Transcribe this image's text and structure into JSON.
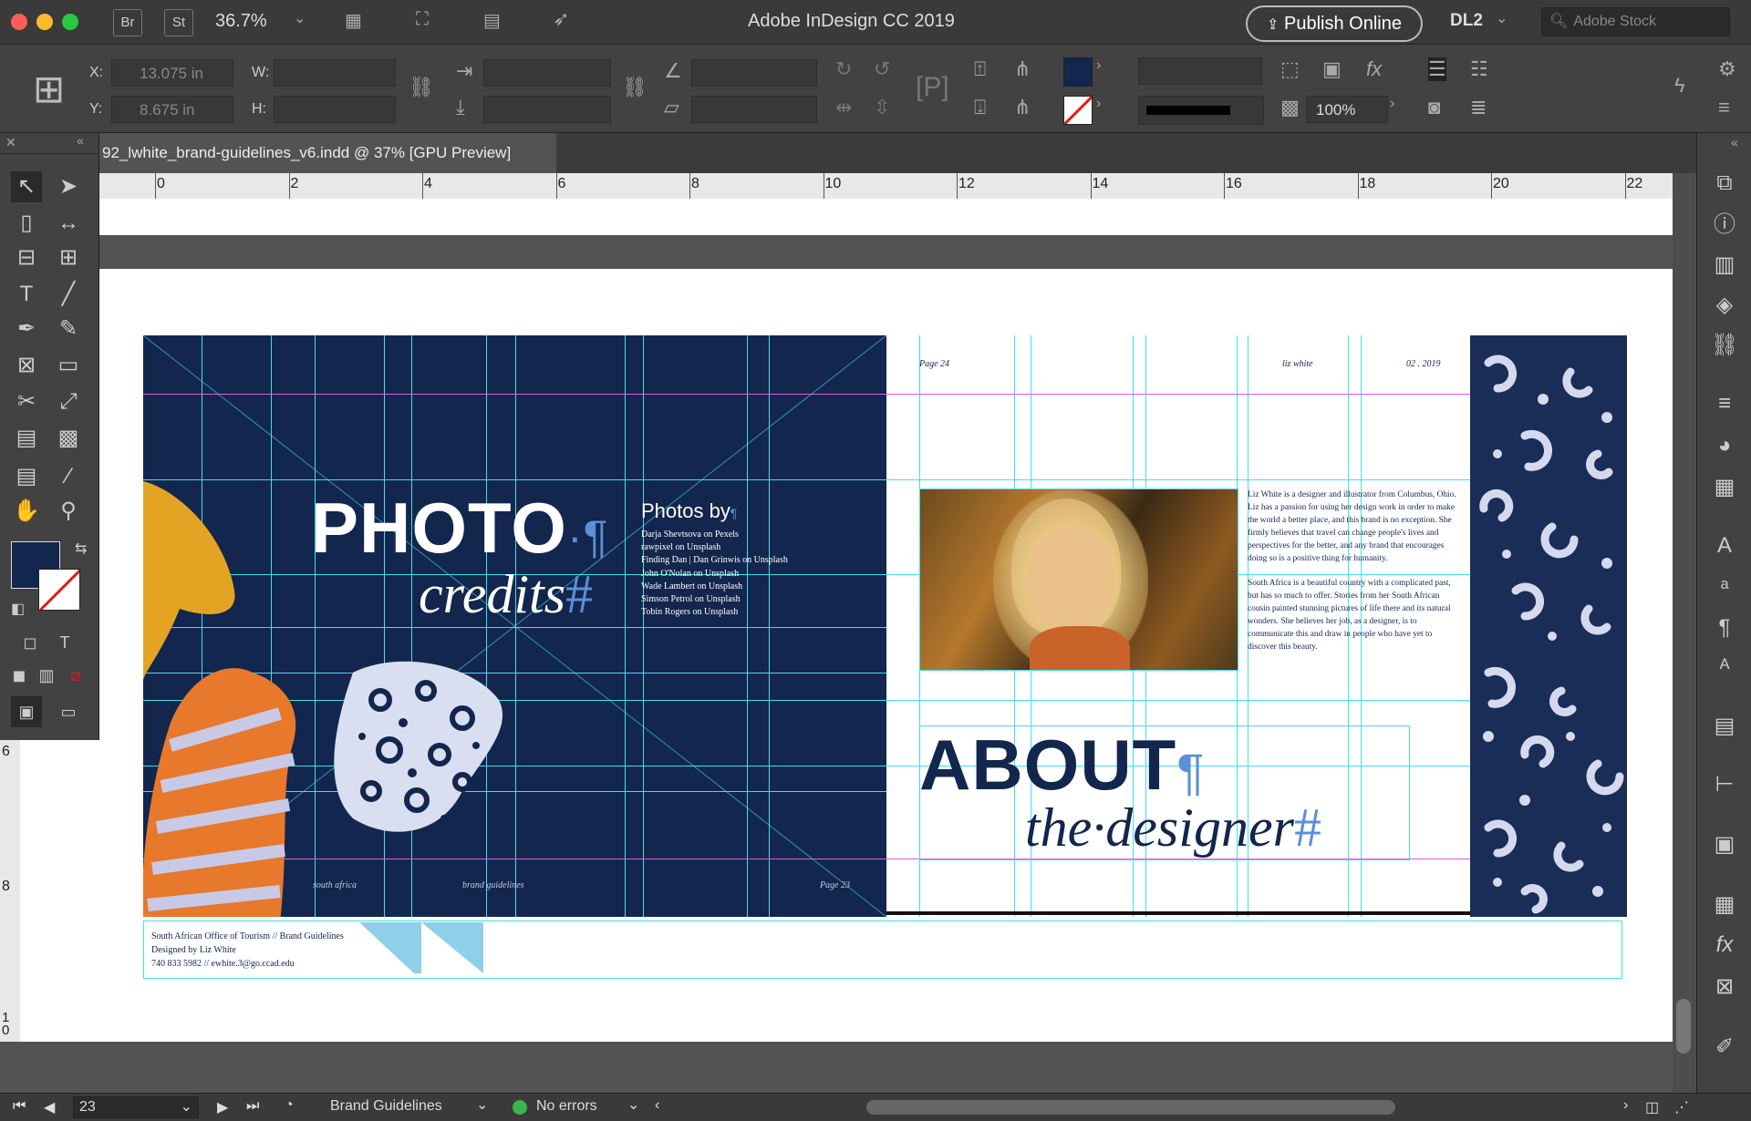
{
  "app": {
    "title": "Adobe InDesign CC 2019",
    "bridge_label": "Br",
    "stock_label": "St",
    "zoom": "36.7%",
    "publish_label": "Publish Online",
    "workspace": "DL2",
    "search_placeholder": "Adobe Stock"
  },
  "control": {
    "x_label": "X:",
    "x_value": "13.075 in",
    "y_label": "Y:",
    "y_value": "8.675 in",
    "w_label": "W:",
    "h_label": "H:",
    "opacity": "100%",
    "fill_color": "#13264d"
  },
  "document": {
    "tab_title": "92_lwhite_brand-guidelines_v6.indd @ 37% [GPU Preview]"
  },
  "ruler": {
    "marks": [
      "0",
      "2",
      "4",
      "6",
      "8",
      "10",
      "12",
      "14",
      "16",
      "18",
      "20",
      "22"
    ],
    "v_marks": [
      "6",
      "8",
      "1\n0"
    ]
  },
  "spread": {
    "left_page": {
      "headline": "PHOTO",
      "headline_mark": "·¶",
      "subhead": "credits",
      "subhead_mark": "#",
      "photos_by": "Photos by",
      "photos_by_mark": "¶",
      "credits": [
        "Darja Shevtsova on Pexels",
        "rawpixel on Unsplash",
        "Finding Dan | Dan Grinwis on Unsplash",
        "John O'Nolan on Unsplash",
        "Wade Lambert on Unsplash",
        "Simson Petrol on Unsplash",
        "Tobin Rogers on Unsplash"
      ],
      "footer_left": "south africa",
      "footer_mid": "brand guidelines",
      "footer_page": "Page 23"
    },
    "right_page": {
      "header_page": "Page 24",
      "header_author": "liz white",
      "header_date": "02 . 2019",
      "bio_1": "Liz White is a designer and illustrator from Columbus, Ohio. Liz has a passion for using her design work in order to make the world a better place, and this brand is no exception. She firmly believes that travel can change people's lives and perspectives for the better, and any brand that encourages doing so is a positive thing for humanity.",
      "bio_2": "South Africa is a beautiful country with a complicated past, but has so much to offer. Stories from her South African cousin painted stunning pictures of life there and its natural wonders. She believes her job, as a designer, is to communicate this and draw in people who have yet to discover this beauty.",
      "headline": "ABOUT",
      "headline_mark": "¶",
      "subhead": "the·designer",
      "subhead_mark": "#"
    },
    "slug": {
      "line1": "South African Office of Tourism // Brand Guidelines",
      "line2": "Designed by Liz White",
      "line3": "740 833 5982 // ewhite.3@go.ccad.edu"
    }
  },
  "status": {
    "page": "23",
    "master": "Brand Guidelines",
    "preflight": "No errors"
  },
  "colors": {
    "navy": "#13264d",
    "accent_blue": "#5b8fd6",
    "guide": "#3fe0ee",
    "orange": "#e8782b",
    "gold": "#e3a423"
  }
}
